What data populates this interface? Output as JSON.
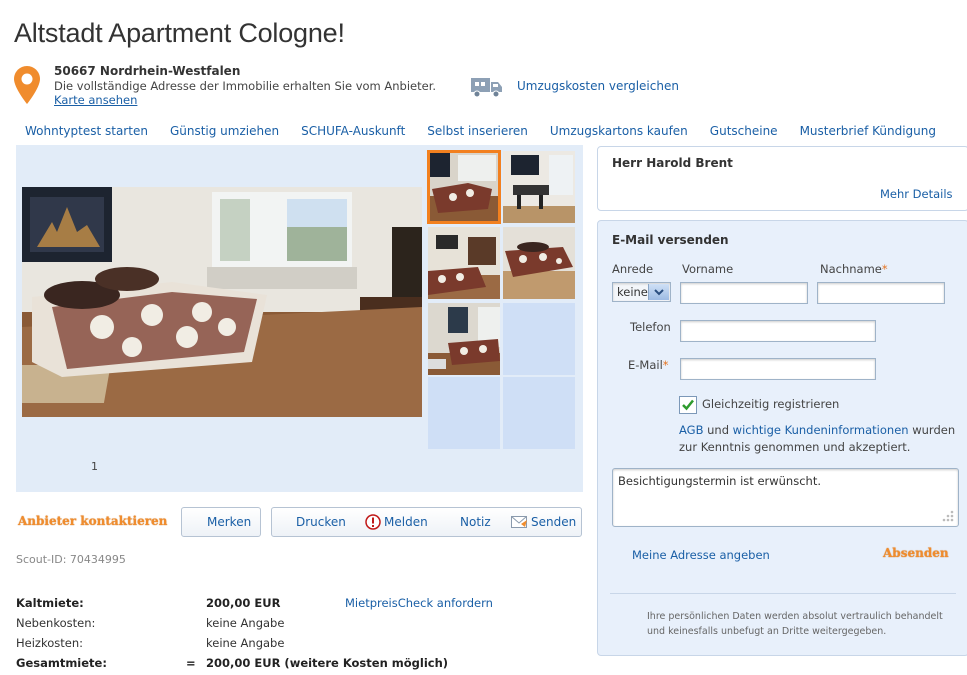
{
  "title": "Altstadt Apartment Cologne!",
  "address": {
    "line1": "50667 Nordrhein-Westfalen",
    "line2": "Die vollständige Adresse der Immobilie erhalten Sie vom Anbieter.",
    "map_link": "Karte ansehen"
  },
  "moving": {
    "link": "Umzugskosten vergleichen"
  },
  "tabs": [
    "Wohntyptest starten",
    "Günstig umziehen",
    "SCHUFA-Auskunft",
    "Selbst inserieren",
    "Umzugskartons kaufen",
    "Gutscheine",
    "Musterbrief Kündigung"
  ],
  "gallery": {
    "page": "1"
  },
  "actions": {
    "contact": "Anbieter kontaktieren",
    "remember": "Merken",
    "print": "Drucken",
    "report": "Melden",
    "note": "Notiz",
    "send": "Senden"
  },
  "scout_id": "Scout-ID: 70434995",
  "costs": {
    "cold_label": "Kaltmiete:",
    "cold_value": "200,00 EUR",
    "check_link": "MietpreisCheck anfordern",
    "extra_label": "Nebenkosten:",
    "extra_value": "keine Angabe",
    "heat_label": "Heizkosten:",
    "heat_value": "keine Angabe",
    "total_label": "Gesamtmiete:",
    "total_eq": "=",
    "total_value": "200,00 EUR (weitere Kosten möglich)"
  },
  "contact_card": {
    "name": "Herr Harold Brent",
    "details": "Mehr Details"
  },
  "form": {
    "heading": "E-Mail versenden",
    "salutation_label": "Anrede",
    "salutation_value": "keine",
    "first_name_label": "Vorname",
    "last_name_label": "Nachname",
    "phone_label": "Telefon",
    "email_label": "E-Mail",
    "required_mark": "*",
    "register_label": "Gleichzeitig registrieren",
    "terms_agb": "AGB",
    "terms_and": "und",
    "terms_info": "wichtige Kundeninformationen",
    "terms_rest": "wurden",
    "terms_line2": "zur Kenntnis genommen und akzeptiert.",
    "message": "Besichtigungstermin ist erwünscht.",
    "address_link": "Meine Adresse angeben",
    "submit": "Absenden",
    "privacy1": "Ihre persönlichen Daten werden absolut vertraulich behandelt",
    "privacy2": "und keinesfalls unbefugt an Dritte weitergegeben."
  },
  "colors": {
    "accent": "#f08c2d",
    "link": "#1a5fa6",
    "panel": "#e8f0fb"
  }
}
